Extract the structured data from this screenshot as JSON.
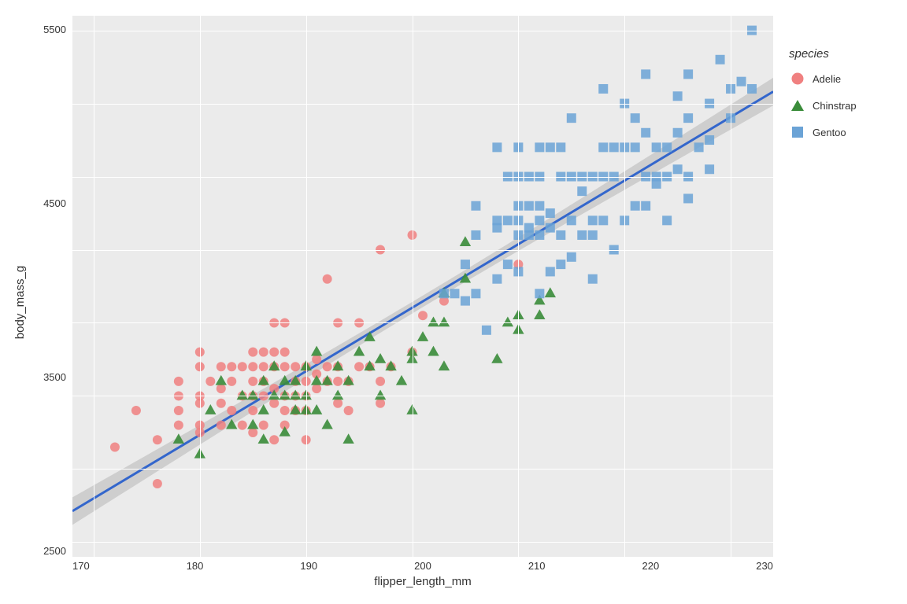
{
  "chart": {
    "title": "",
    "x_label": "flipper_length_mm",
    "y_label": "body_mass_g",
    "x_ticks": [
      "170",
      "180",
      "190",
      "200",
      "210",
      "220",
      "230"
    ],
    "y_ticks": [
      "2500",
      "3500",
      "4500",
      "5500"
    ],
    "background_color": "#ebebeb",
    "grid_color": "#ffffff"
  },
  "legend": {
    "title": "species",
    "items": [
      {
        "label": "Adelie",
        "shape": "circle",
        "color": "#f08080"
      },
      {
        "label": "Chinstrap",
        "shape": "triangle",
        "color": "#3a8c3a"
      },
      {
        "label": "Gentoo",
        "shape": "square",
        "color": "#6ba3d6"
      }
    ]
  },
  "trend_line": {
    "color": "#3366cc",
    "band_color": "rgba(150,150,150,0.4)"
  }
}
